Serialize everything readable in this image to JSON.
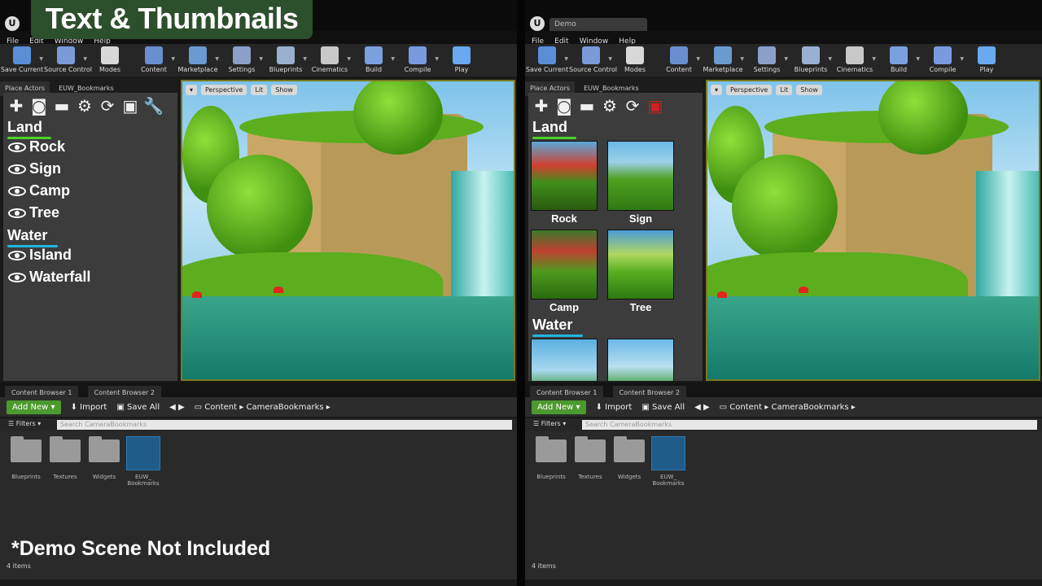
{
  "overlay": {
    "title": "Text & Thumbnails",
    "footnote": "*Demo Scene Not Included"
  },
  "window": {
    "tab_title": "Demo",
    "logo": "U"
  },
  "menu": [
    "File",
    "Edit",
    "Window",
    "Help"
  ],
  "toolbar": [
    {
      "label": "Save Current",
      "icon": "save-icon",
      "color": "#5a8fd8"
    },
    {
      "label": "Source Control",
      "icon": "source-control-icon",
      "color": "#7a9ad8"
    },
    {
      "label": "Modes",
      "icon": "modes-icon",
      "color": "#d8d8d8"
    },
    {
      "label": "Content",
      "icon": "content-icon",
      "color": "#6a8fd0"
    },
    {
      "label": "Marketplace",
      "icon": "marketplace-icon",
      "color": "#6a9ad0"
    },
    {
      "label": "Settings",
      "icon": "settings-icon",
      "color": "#8aa0c8"
    },
    {
      "label": "Blueprints",
      "icon": "blueprints-icon",
      "color": "#9ab0d0"
    },
    {
      "label": "Cinematics",
      "icon": "cinematics-icon",
      "color": "#c8c8c8"
    },
    {
      "label": "Build",
      "icon": "build-icon",
      "color": "#7aa0e0"
    },
    {
      "label": "Compile",
      "icon": "compile-icon",
      "color": "#7a9ae0"
    },
    {
      "label": "Play",
      "icon": "play-icon",
      "color": "#6aa8f0"
    }
  ],
  "panel_tabs": [
    "Place Actors",
    "EUW_Bookmarks"
  ],
  "bookmarks": {
    "categories": [
      {
        "name": "Land",
        "color": "#4cd02a",
        "items": [
          "Rock",
          "Sign",
          "Camp",
          "Tree"
        ]
      },
      {
        "name": "Water",
        "color": "#21b7e0",
        "items": [
          "Island",
          "Waterfall"
        ]
      }
    ]
  },
  "viewport": {
    "perspective": "Perspective",
    "lit": "Lit",
    "show": "Show"
  },
  "content_browser": {
    "tabs": [
      "Content Browser 1",
      "Content Browser 2"
    ],
    "add_new": "Add New",
    "import": "Import",
    "save_all": "Save All",
    "path": [
      "Content",
      "CameraBookmarks"
    ],
    "filters": "Filters",
    "search_placeholder": "Search CameraBookmarks",
    "assets": [
      "Blueprints",
      "Textures",
      "Widgets",
      "EUW_ Bookmarks"
    ],
    "item_count": "4 items"
  }
}
